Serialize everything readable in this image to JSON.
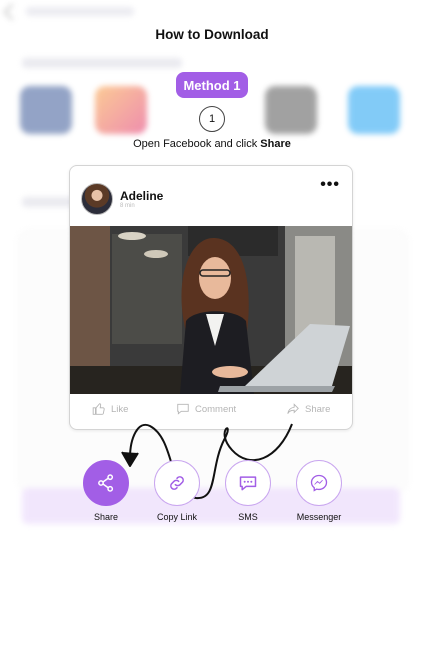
{
  "page_title": "How to Download",
  "method_badge": "Method 1",
  "step_number": "1",
  "instruction_prefix": "Open Facebook and click ",
  "instruction_bold": "Share",
  "post": {
    "user_name": "Adeline",
    "time": "8 min",
    "more_icon": "•••",
    "actions": {
      "like": "Like",
      "comment": "Comment",
      "share": "Share"
    }
  },
  "share_options": [
    {
      "label": "Share",
      "icon": "share-icon"
    },
    {
      "label": "Copy Link",
      "icon": "link-icon"
    },
    {
      "label": "SMS",
      "icon": "sms-icon"
    },
    {
      "label": "Messenger",
      "icon": "messenger-icon"
    }
  ],
  "colors": {
    "accent": "#a25ee6",
    "accent_light": "#e7d3fb"
  }
}
